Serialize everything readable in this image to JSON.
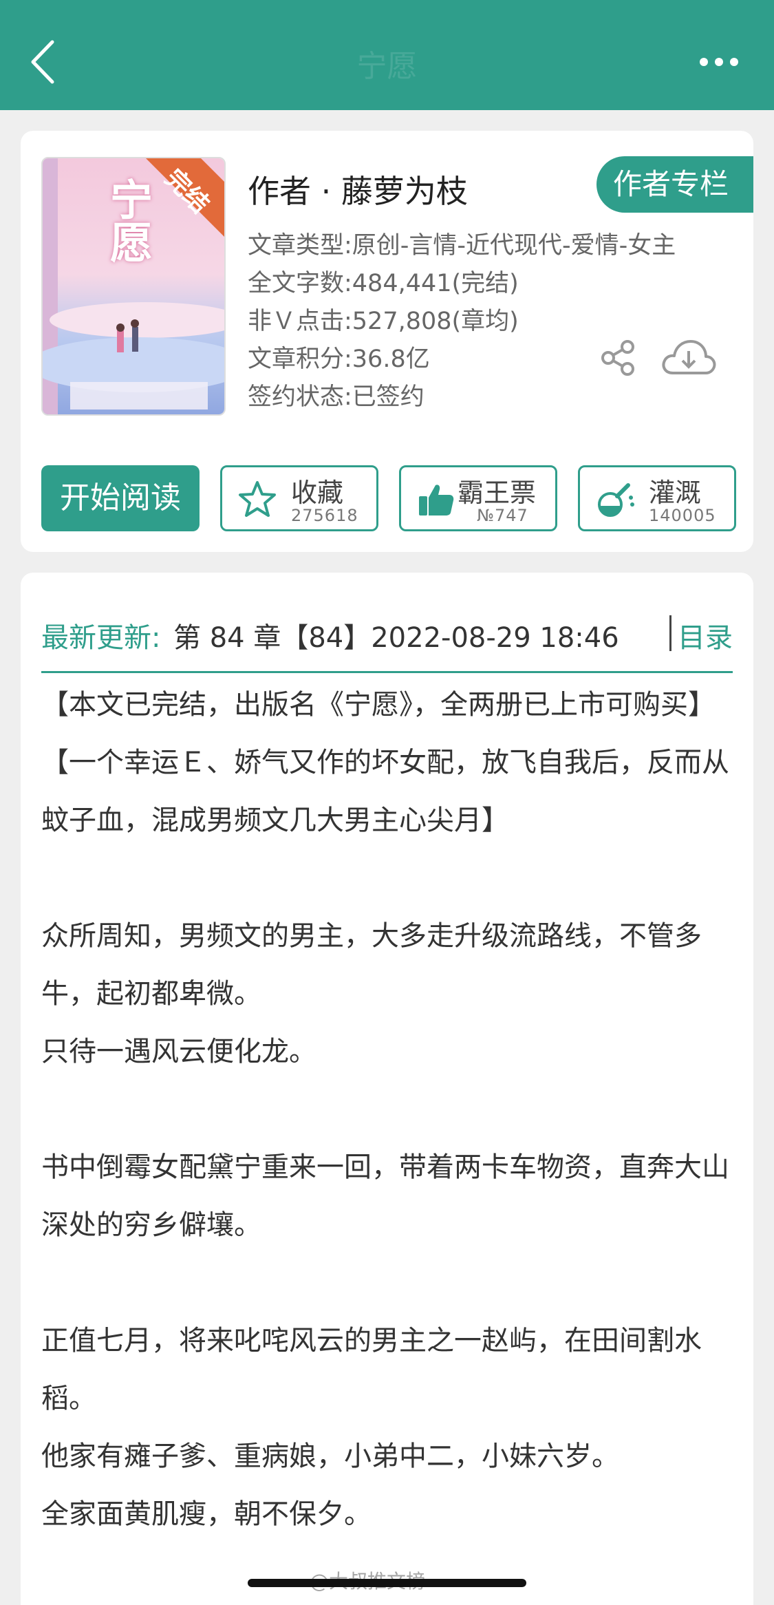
{
  "nav": {
    "title": "宁愿",
    "back_icon": "chevron-left-icon",
    "more_icon": "more-dots-icon"
  },
  "book": {
    "cover": {
      "title": "宁愿",
      "badge": "完结"
    },
    "author": "作者 · 藤萝为枝",
    "author_column_label": "作者专栏",
    "meta": [
      "文章类型:原创-言情-近代现代-爱情-女主",
      "全文字数:484,441(完结)",
      "非Ｖ点击:527,808(章均)",
      "文章积分:36.8亿",
      "签约状态:已签约"
    ],
    "actions": {
      "read_label": "开始阅读",
      "collect_label": "收藏",
      "collect_count": "275618",
      "vote_label": "霸王票",
      "vote_count": "№747",
      "nutrient_label": "灌溉",
      "nutrient_count": "140005"
    }
  },
  "latest": {
    "label": "最新更新:",
    "value": "第 84 章【84】2022-08-29 18:46",
    "toc_label": "目录"
  },
  "intro_lines": [
    "【本文已完结，出版名《宁愿》，全两册已上市可购买】",
    "【一个幸运Ｅ、娇气又作的坏女配，放飞自我后，反而从蚊子血，混成男频文几大男主心尖月】",
    "",
    "众所周知，男频文的男主，大多走升级流路线，不管多牛，起初都卑微。",
    "只待一遇风云便化龙。",
    "",
    "书中倒霉女配黛宁重来一回，带着两卡车物资，直奔大山深处的穷乡僻壤。",
    "",
    "正值七月，将来叱咤风云的男主之一赵屿，在田间割水稻。",
    "他家有瘫子爹、重病娘，小弟中二，小妹六岁。",
    "全家面黄肌瘦，朝不保夕。"
  ],
  "watermark": "@大叔推文榜",
  "colors": {
    "accent": "#2f9e8b",
    "background": "#efefef"
  }
}
